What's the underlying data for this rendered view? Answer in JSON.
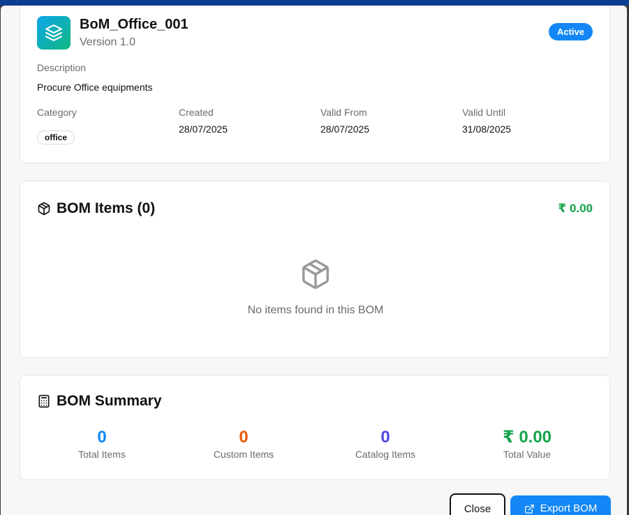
{
  "bom": {
    "title": "BoM_Office_001",
    "version": "Version 1.0",
    "status": "Active",
    "description_label": "Description",
    "description": "Procure Office equipments",
    "category_label": "Category",
    "category": "office",
    "created_label": "Created",
    "created": "28/07/2025",
    "valid_from_label": "Valid From",
    "valid_from": "28/07/2025",
    "valid_until_label": "Valid Until",
    "valid_until": "31/08/2025"
  },
  "items": {
    "title": "BOM Items (0)",
    "total": "₹ 0.00",
    "empty_text": "No items found in this BOM"
  },
  "summary": {
    "title": "BOM Summary",
    "stats": [
      {
        "value": "0",
        "label": "Total Items",
        "color": "#1287f5"
      },
      {
        "value": "0",
        "label": "Custom Items",
        "color": "#ea580c"
      },
      {
        "value": "0",
        "label": "Catalog Items",
        "color": "#4f46e5"
      },
      {
        "value": "₹ 0.00",
        "label": "Total Value",
        "color": "#16a34a"
      }
    ]
  },
  "footer": {
    "close_label": "Close",
    "export_label": "Export BOM"
  },
  "icons": {
    "app": "layers-icon",
    "items": "package-icon",
    "empty": "package-icon",
    "summary": "calculator-icon",
    "export": "external-link-icon"
  },
  "colors": {
    "accent": "#1287f5",
    "success": "#16a34a"
  }
}
